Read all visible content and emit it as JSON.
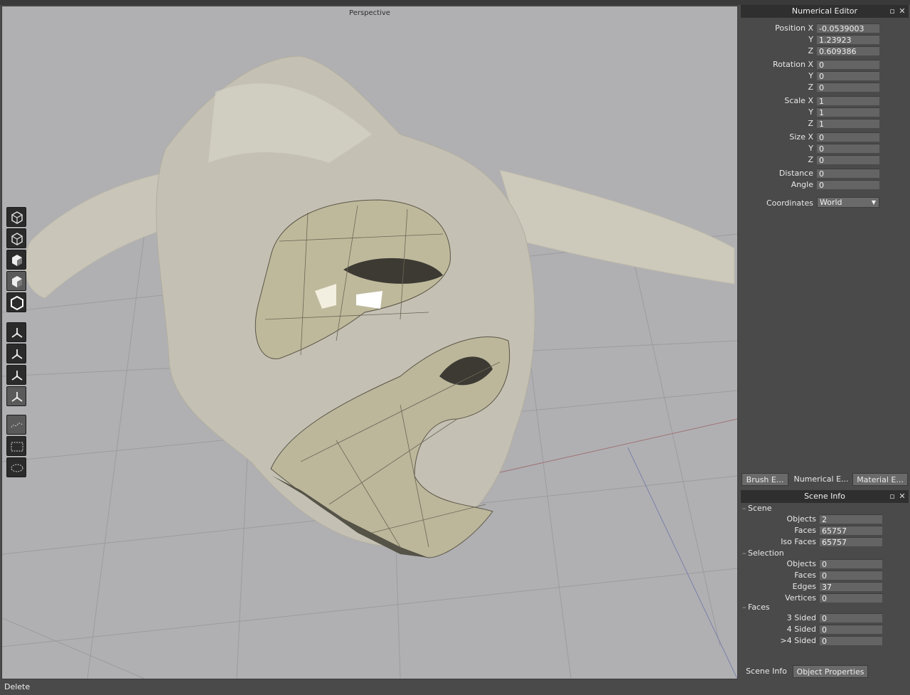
{
  "viewport": {
    "title": "Perspective"
  },
  "toolbar": {
    "icons": [
      "select-vertex-icon",
      "select-edge-icon",
      "select-face-icon",
      "select-object-icon",
      "select-shell-icon",
      "move-tool-icon",
      "rotate-tool-icon",
      "scale-tool-icon",
      "universal-manipulator-icon",
      "lasso-freehand-icon",
      "rect-marquee-icon",
      "ellipse-marquee-icon"
    ]
  },
  "numerical_editor": {
    "title": "Numerical Editor",
    "position_label": "Position X",
    "position_x": "-0.0539003",
    "position_y": "1.23923",
    "position_z": "0.609386",
    "rotation_label": "Rotation X",
    "rotation_x": "0",
    "rotation_y": "0",
    "rotation_z": "0",
    "scale_label": "Scale X",
    "scale_x": "1",
    "scale_y": "1",
    "scale_z": "1",
    "size_label": "Size X",
    "size_x": "0",
    "size_y": "0",
    "size_z": "0",
    "y_label": "Y",
    "z_label": "Z",
    "distance_label": "Distance",
    "distance": "0",
    "angle_label": "Angle",
    "angle": "0",
    "coordinates_label": "Coordinates",
    "coordinates": "World"
  },
  "panel_tabs": [
    "Brush E...",
    "Numerical E...",
    "Material E..."
  ],
  "scene_info": {
    "title": "Scene Info",
    "scene_group": "Scene",
    "scene_objects_label": "Objects",
    "scene_objects": "2",
    "scene_faces_label": "Faces",
    "scene_faces": "65757",
    "scene_iso_label": "Iso Faces",
    "scene_iso": "65757",
    "selection_group": "Selection",
    "sel_objects_label": "Objects",
    "sel_objects": "0",
    "sel_faces_label": "Faces",
    "sel_faces": "0",
    "sel_edges_label": "Edges",
    "sel_edges": "37",
    "sel_vertices_label": "Vertices",
    "sel_vertices": "0",
    "faces_group": "Faces",
    "three_label": "3 Sided",
    "three": "0",
    "four_label": "4 Sided",
    "four": "0",
    "more_label": ">4 Sided",
    "more": "0"
  },
  "bottom_tabs": [
    "Scene Info",
    "Object Properties"
  ],
  "status": {
    "text": "Delete"
  },
  "colors": {
    "viewport_bg": "#b0b0b3",
    "mesh": "#cfcbb8",
    "panel_bg": "#4a4a4a",
    "title_bar": "#2f2f2f"
  }
}
